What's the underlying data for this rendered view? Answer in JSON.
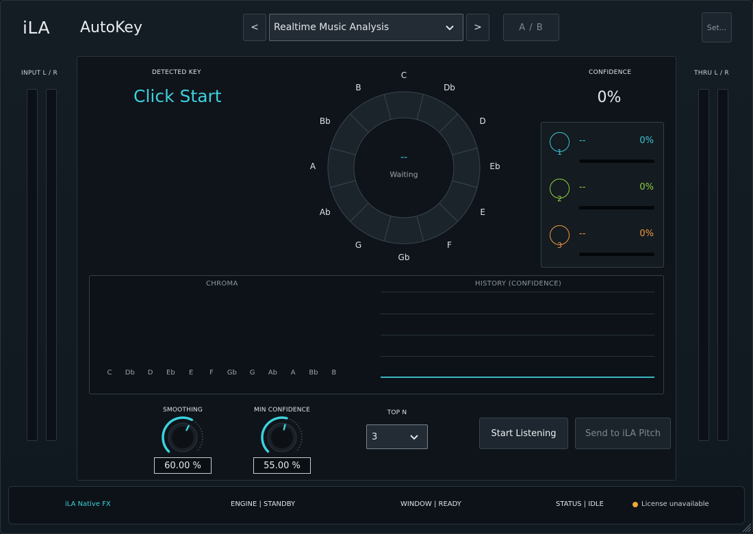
{
  "header": {
    "brand": "iLA",
    "app_name": "AutoKey",
    "prev_label": "<",
    "next_label": ">",
    "preset_name": "Realtime Music Analysis",
    "ab_label": "A / B",
    "settings_label": "Set..."
  },
  "meters": {
    "input_label": "INPUT  L / R",
    "thru_label": "THRU  L / R"
  },
  "detected": {
    "label": "DETECTED KEY",
    "value": "Click Start"
  },
  "confidence": {
    "label": "CONFIDENCE",
    "value": "0%"
  },
  "wheel": {
    "notes": [
      "C",
      "Db",
      "D",
      "Eb",
      "E",
      "F",
      "Gb",
      "G",
      "Ab",
      "A",
      "Bb",
      "B"
    ],
    "center_key": "--",
    "center_status": "Waiting"
  },
  "candidates": [
    {
      "rank": "1",
      "key": "--",
      "pct": "0%",
      "color": "#3dc6d6"
    },
    {
      "rank": "2",
      "key": "--",
      "pct": "0%",
      "color": "#8fd23e"
    },
    {
      "rank": "3",
      "key": "--",
      "pct": "0%",
      "color": "#f39a3d"
    }
  ],
  "chroma": {
    "title": "CHROMA",
    "labels": [
      "C",
      "Db",
      "D",
      "Eb",
      "E",
      "F",
      "Gb",
      "G",
      "Ab",
      "A",
      "Bb",
      "B"
    ]
  },
  "history": {
    "title": "HISTORY (CONFIDENCE)"
  },
  "controls": {
    "smoothing_label": "SMOOTHING",
    "smoothing_value": "60.00 %",
    "smoothing_level": 0.6,
    "min_conf_label": "MIN CONFIDENCE",
    "min_conf_value": "55.00 %",
    "min_conf_level": 0.55,
    "topn_label": "TOP N",
    "topn_value": "3",
    "start_label": "Start Listening",
    "send_label": "Send to iLA Pitch"
  },
  "footer": {
    "brand": "iLA  Native FX",
    "engine": "ENGINE  |  STANDBY",
    "window": "WINDOW  |  READY",
    "status": "STATUS  |  IDLE",
    "license": "License unavailable"
  },
  "colors": {
    "accent": "#3dd1dd",
    "license_dot": "#f0a53a"
  }
}
